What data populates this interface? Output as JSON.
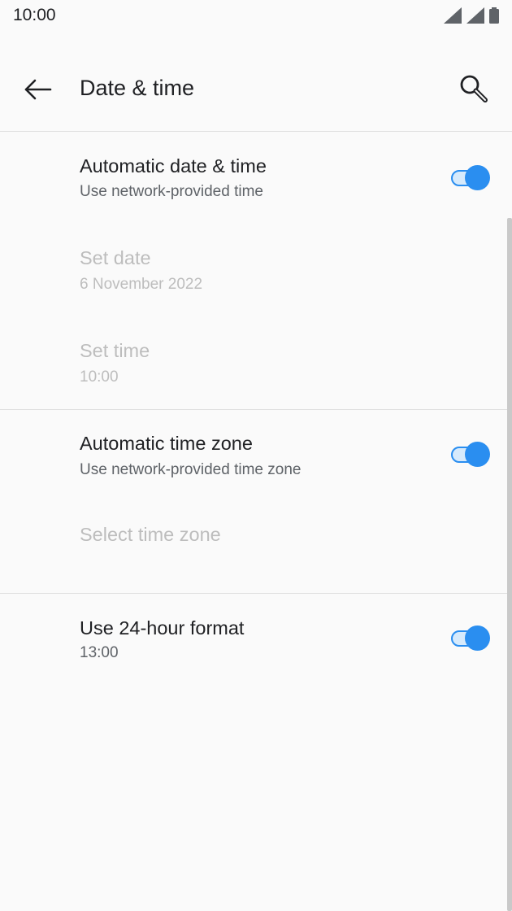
{
  "status_bar": {
    "time": "10:00"
  },
  "app_bar": {
    "title": "Date & time"
  },
  "settings": {
    "auto_datetime": {
      "title": "Automatic date & time",
      "subtitle": "Use network-provided time",
      "enabled": true
    },
    "set_date": {
      "title": "Set date",
      "subtitle": "6 November 2022"
    },
    "set_time": {
      "title": "Set time",
      "subtitle": "10:00"
    },
    "auto_timezone": {
      "title": "Automatic time zone",
      "subtitle": "Use network-provided time zone",
      "enabled": true
    },
    "select_timezone": {
      "title": "Select time zone"
    },
    "hour24": {
      "title": "Use 24-hour format",
      "subtitle": "13:00",
      "enabled": true
    }
  },
  "colors": {
    "accent": "#2a8ef0",
    "disabled_text": "#bdbdbd",
    "background": "#fafafa"
  }
}
